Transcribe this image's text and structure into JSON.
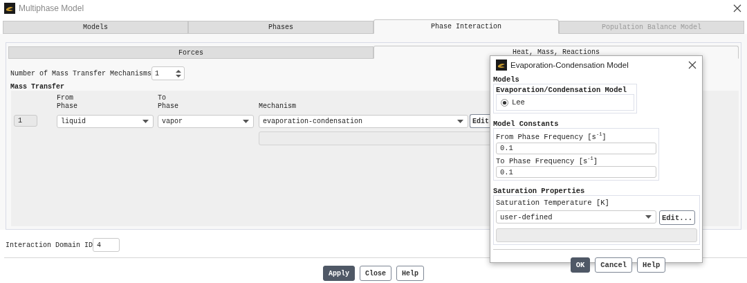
{
  "window": {
    "title": "Multiphase Model"
  },
  "tabs": [
    {
      "label": "Models",
      "selected": false,
      "disabled": false
    },
    {
      "label": "Phases",
      "selected": false,
      "disabled": false
    },
    {
      "label": "Phase Interaction",
      "selected": true,
      "disabled": false
    },
    {
      "label": "Population Balance Model",
      "selected": false,
      "disabled": true
    }
  ],
  "subtabs": [
    {
      "label": "Forces",
      "selected": false
    },
    {
      "label": "Heat, Mass, Reactions",
      "selected": true
    }
  ],
  "mechanism_count": {
    "label": "Number of Mass Transfer Mechanisms",
    "value": "1"
  },
  "mass_transfer": {
    "title": "Mass Transfer",
    "columns": [
      "From\nPhase",
      "To\nPhase",
      "Mechanism"
    ],
    "rows": [
      {
        "index": "1",
        "from_phase": "liquid",
        "to_phase": "vapor",
        "mechanism": "evaporation-condensation",
        "edit": "Edit"
      }
    ]
  },
  "interaction_domain": {
    "label": "Interaction Domain ID",
    "value": "4"
  },
  "buttons": [
    {
      "label": "Apply",
      "default": true
    },
    {
      "label": "Close",
      "default": false
    },
    {
      "label": "Help",
      "default": false
    }
  ],
  "dialog": {
    "title": "Evaporation-Condensation Model",
    "models": {
      "title": "Models",
      "group": "Evaporation/Condensation Model",
      "options": [
        {
          "label": "Lee",
          "selected": true
        }
      ]
    },
    "constants": {
      "title": "Model Constants",
      "fields": [
        {
          "label": "From Phase Frequency [s$^{-1}$]",
          "value": "0.1"
        },
        {
          "label": "To Phase Frequency [s$^{-1}$]",
          "value": "0.1"
        }
      ]
    },
    "saturation": {
      "title": "Saturation Properties",
      "label": "Saturation Temperature [K]",
      "value": "user-defined",
      "edit": "Edit..."
    },
    "buttons": [
      {
        "label": "OK",
        "default": true
      },
      {
        "label": "Cancel",
        "default": false
      },
      {
        "label": "Help",
        "default": false
      }
    ]
  }
}
